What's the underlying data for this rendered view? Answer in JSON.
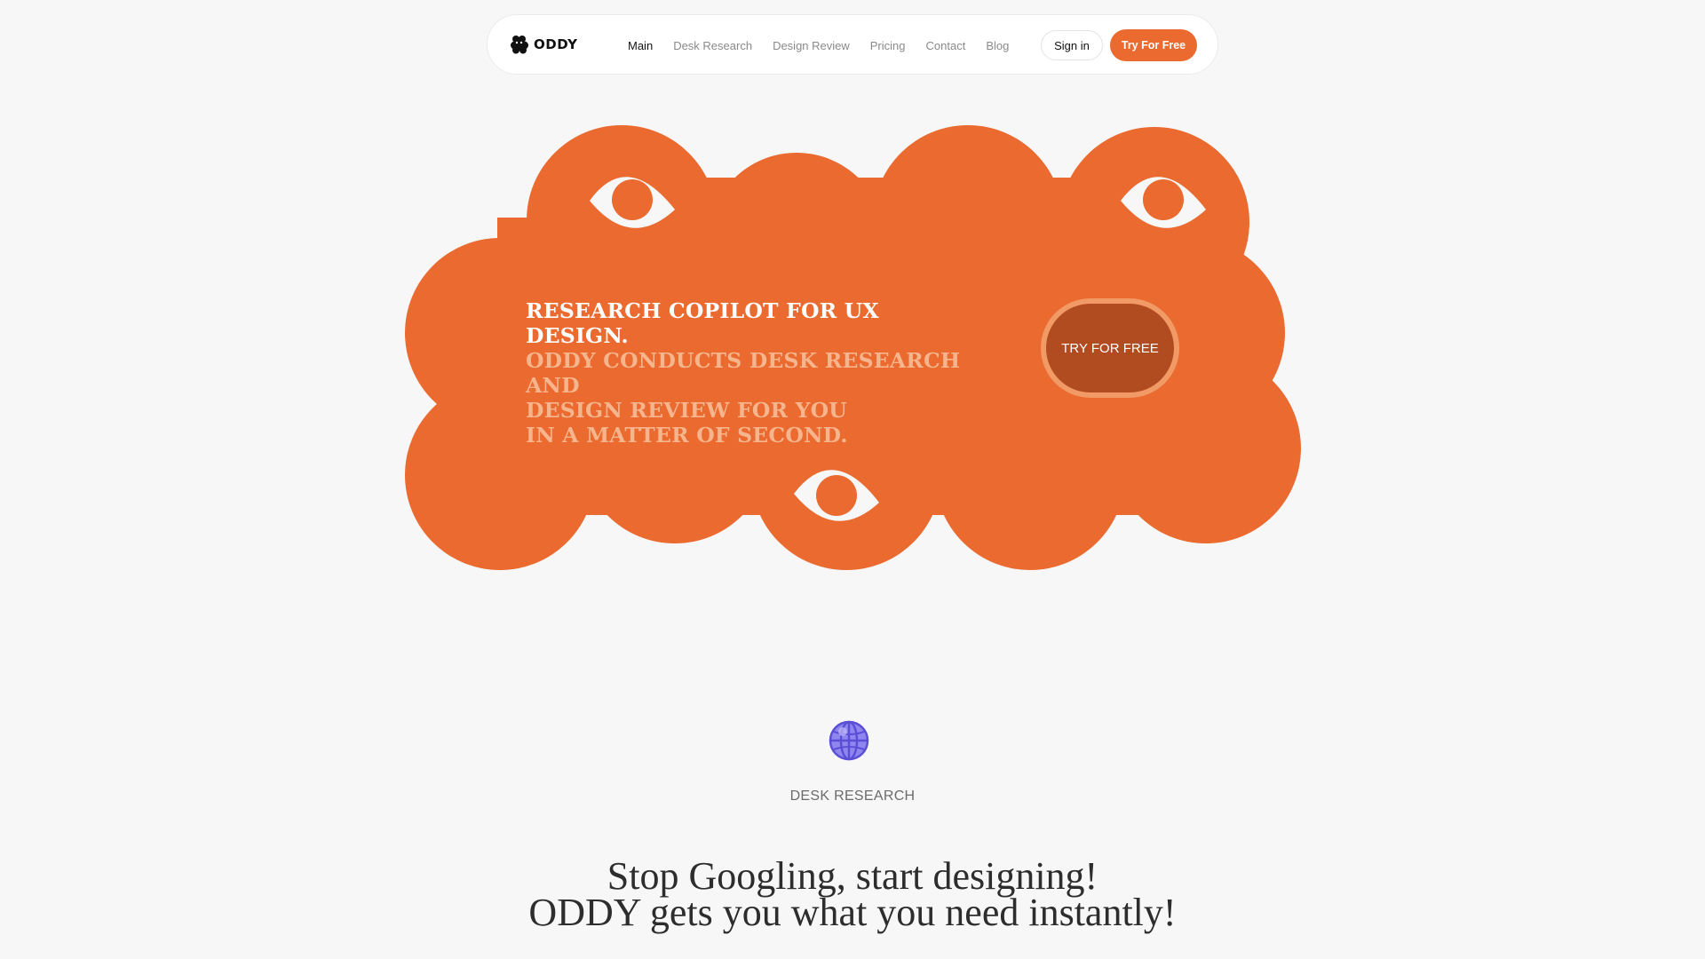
{
  "nav": {
    "brand": "ODDY",
    "links": [
      {
        "label": "Main",
        "active": true
      },
      {
        "label": "Desk Research",
        "active": false
      },
      {
        "label": "Design Review",
        "active": false
      },
      {
        "label": "Pricing",
        "active": false
      },
      {
        "label": "Contact",
        "active": false
      },
      {
        "label": "Blog",
        "active": false
      }
    ],
    "sign_in": "Sign in",
    "try_free": "Try For Free"
  },
  "hero": {
    "line1": "RESEARCH COPILOT FOR UX DESIGN.",
    "line2": "ODDY CONDUCTS DESK RESEARCH AND",
    "line3": "DESIGN REVIEW FOR YOU",
    "line4": "IN A MATTER OF SECOND.",
    "cta": "TRY FOR FREE"
  },
  "desk_research": {
    "icon": "globe-icon",
    "label": "DESK RESEARCH",
    "heading_line1": "Stop Googling, start designing!",
    "heading_line2": "ODDY gets you what you need instantly!"
  },
  "colors": {
    "background": "#f7f7f7",
    "accent": "#ea6a2f",
    "cta_dark": "#b14b20",
    "text_muted": "#f6b58d"
  }
}
